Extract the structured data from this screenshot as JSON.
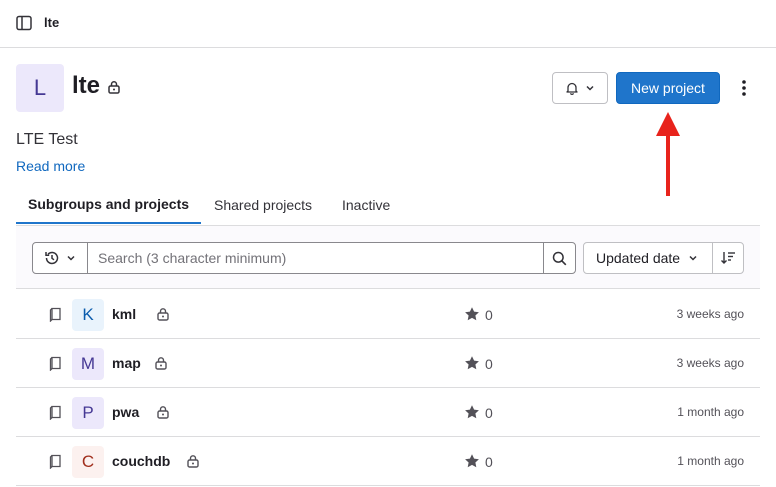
{
  "breadcrumb": {
    "group": "lte"
  },
  "group": {
    "avatar_letter": "L",
    "name": "lte",
    "description": "LTE Test",
    "read_more": "Read more"
  },
  "header_actions": {
    "new_project": "New project"
  },
  "tabs": [
    {
      "label": "Subgroups and projects",
      "active": true
    },
    {
      "label": "Shared projects",
      "active": false
    },
    {
      "label": "Inactive",
      "active": false
    }
  ],
  "filter": {
    "search_placeholder": "Search (3 character minimum)",
    "sort_label": "Updated date"
  },
  "projects": [
    {
      "avatar": "K",
      "name": "kml",
      "stars": "0",
      "updated": "3 weeks ago",
      "avatar_bg": "#e9f3fc",
      "avatar_fg": "#0b5cad"
    },
    {
      "avatar": "M",
      "name": "map",
      "stars": "0",
      "updated": "3 weeks ago",
      "avatar_bg": "#ece8fb",
      "avatar_fg": "#453894"
    },
    {
      "avatar": "P",
      "name": "pwa",
      "stars": "0",
      "updated": "1 month ago",
      "avatar_bg": "#ece8fb",
      "avatar_fg": "#453894"
    },
    {
      "avatar": "C",
      "name": "couchdb",
      "stars": "0",
      "updated": "1 month ago",
      "avatar_bg": "#fcf1ef",
      "avatar_fg": "#a02e1c"
    }
  ],
  "colors": {
    "primary": "#1f75cb",
    "annotation_arrow": "#e8231c",
    "link": "#1068bf"
  }
}
